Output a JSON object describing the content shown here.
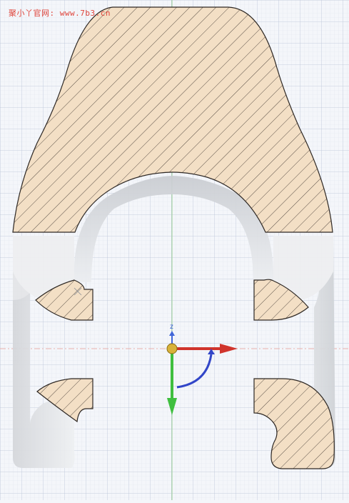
{
  "watermark": {
    "text": "聚小丫官网: www.7b3.cn",
    "color": "#e0463c"
  },
  "colors": {
    "background": "#f4f6fa",
    "grid_minor": "#dfe5ee",
    "grid_major": "#b9c4d6",
    "axis_green_line": "#9fd49a",
    "axis_red_line": "#e9b0ac",
    "section_fill": "#f3dfc5",
    "section_hatch": "#4a4038",
    "section_edge": "#2e2824",
    "body_shading": "#d9dadd"
  },
  "gizmo": {
    "z_label": "z",
    "x_axis_color": "#d0342c",
    "y_axis_color": "#3fbf3f",
    "z_axis_color": "#4166d8",
    "rotation_arc_color": "#3246c8",
    "origin_color": "#d8b23a"
  }
}
